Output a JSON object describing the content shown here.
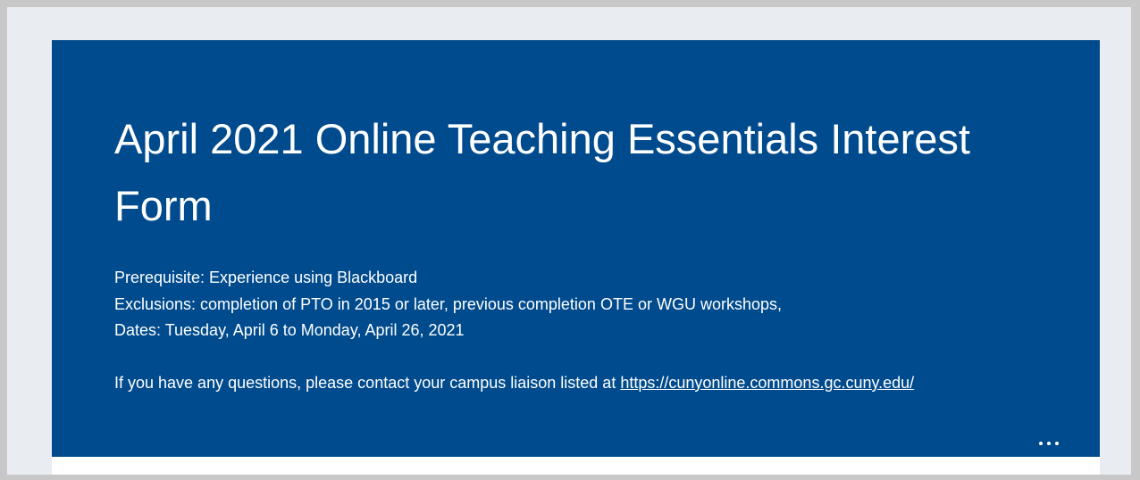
{
  "form": {
    "title": "April 2021 Online Teaching Essentials Interest Form",
    "description": {
      "prerequisite": "Prerequisite: Experience using Blackboard",
      "exclusions": "Exclusions: completion of PTO in 2015 or later, previous completion OTE or WGU workshops,",
      "dates": "Dates: Tuesday, April 6 to Monday, April 26, 2021",
      "contact_prefix": "If you have any questions, please contact your campus liaison listed at ",
      "contact_link": "https://cunyonline.commons.gc.cuny.edu/"
    },
    "more_icon": "more-horizontal-icon"
  },
  "colors": {
    "header_background": "#004b8d",
    "page_background": "#e9edf2",
    "text": "#ffffff"
  }
}
